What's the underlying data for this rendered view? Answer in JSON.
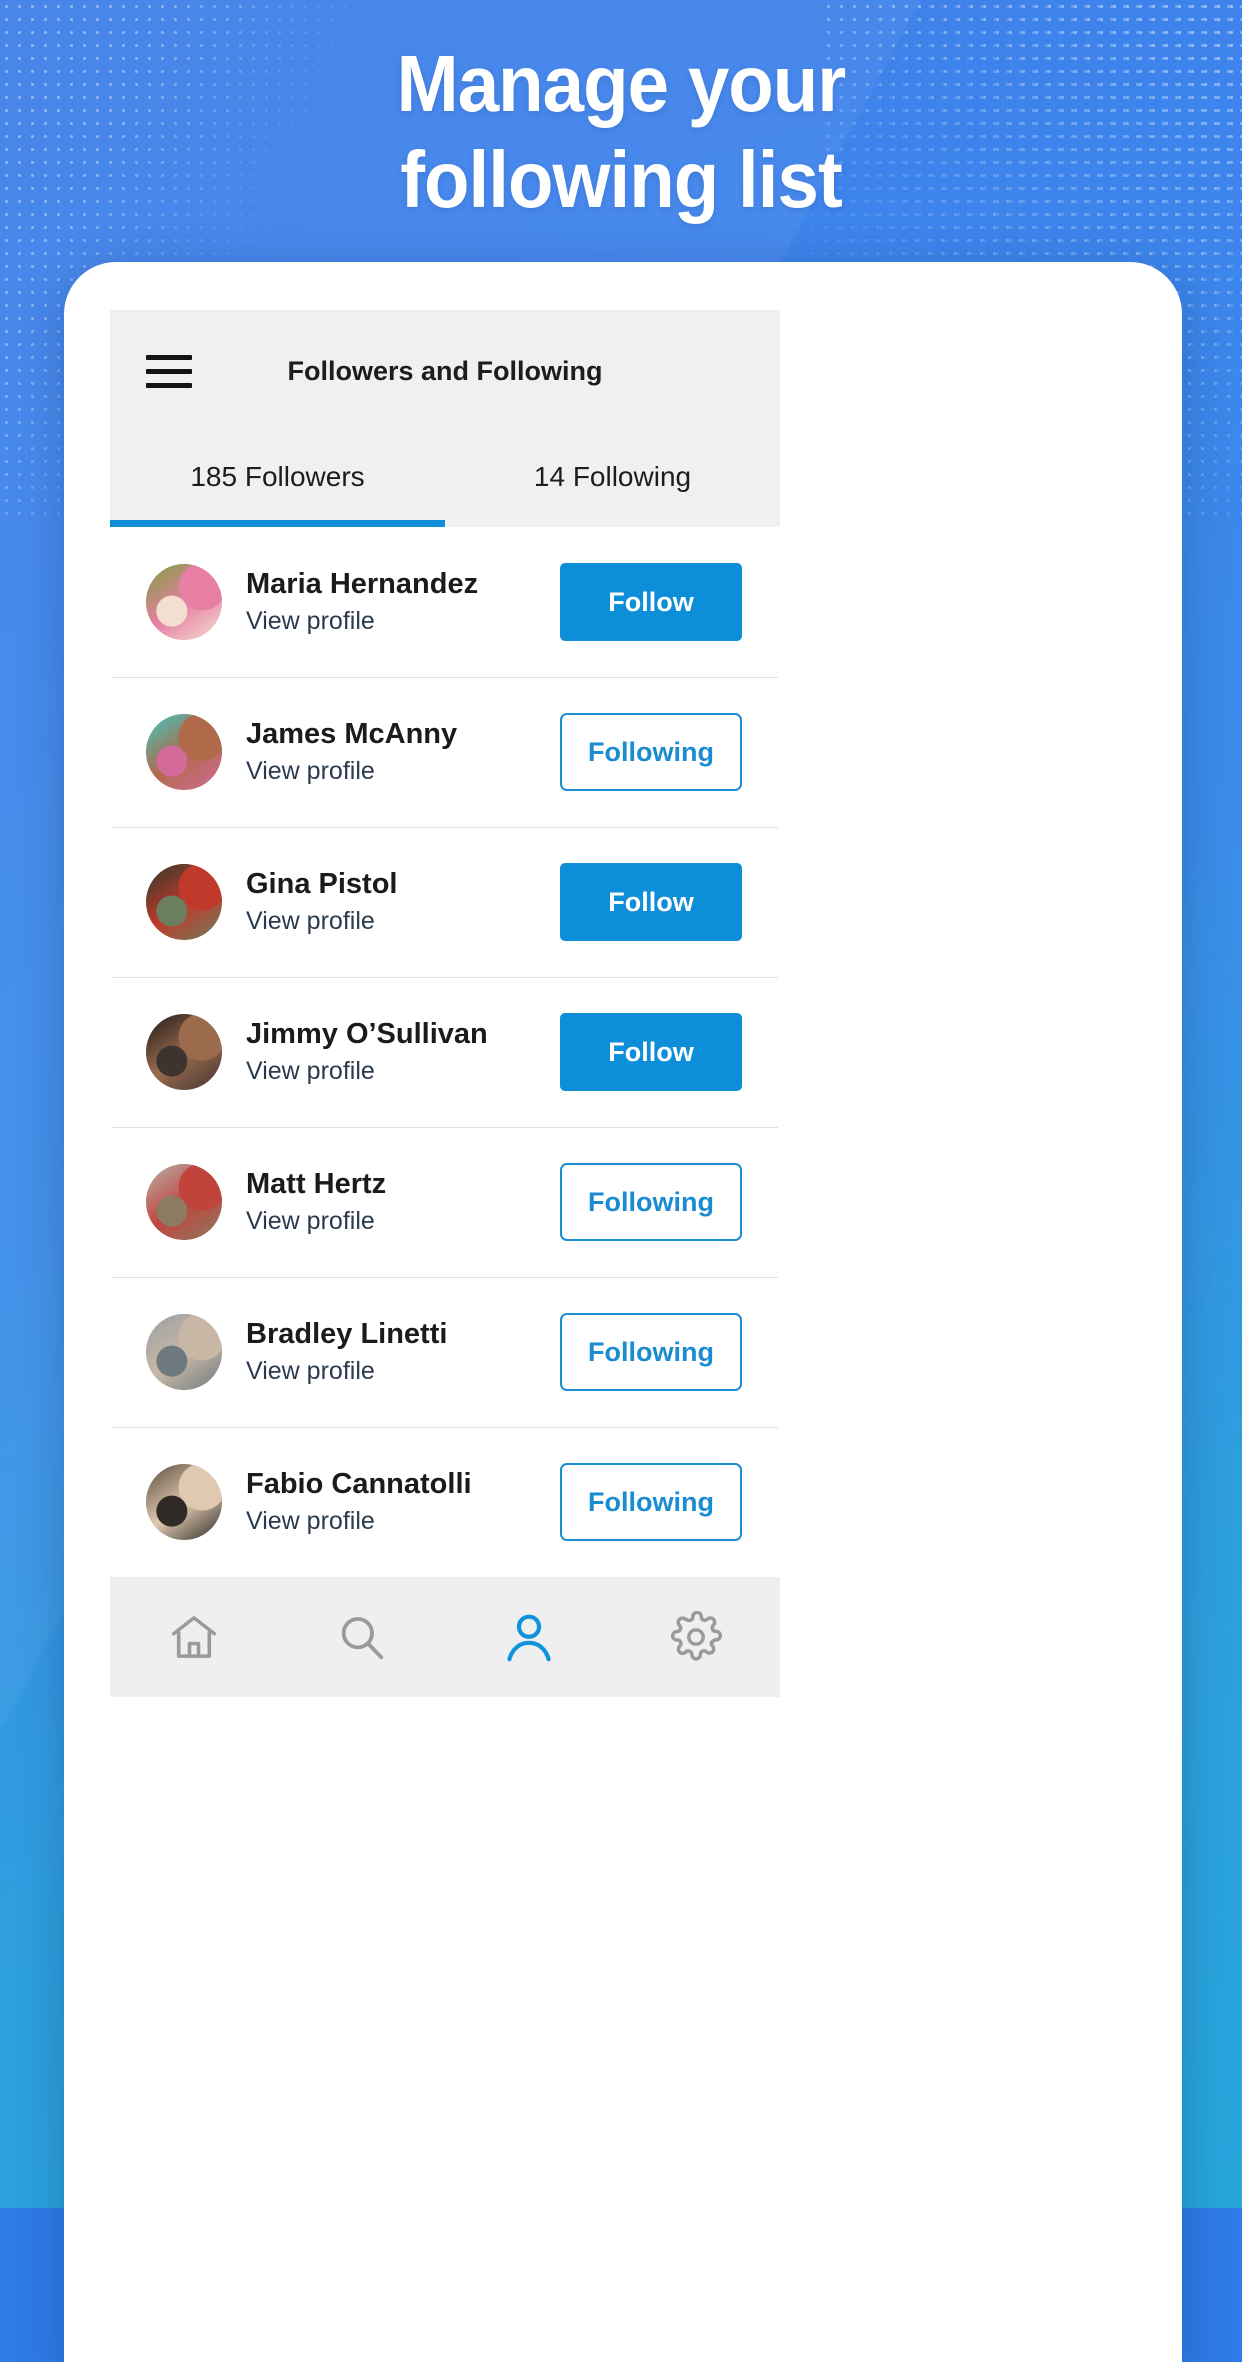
{
  "hero": {
    "line1": "Manage your",
    "line2": "following list",
    "bg_start": "#3f7fe8",
    "bg_end": "#27a6dc"
  },
  "app": {
    "menu_icon": "hamburger-menu-icon",
    "title": "Followers and Following",
    "accent": "#0c8ed9",
    "tabs": [
      {
        "label": "185 Followers",
        "active": true
      },
      {
        "label": "14 Following",
        "active": false
      }
    ],
    "subtitle_label": "View profile",
    "follow_label": "Follow",
    "following_label": "Following",
    "people": [
      {
        "name": "Maria Hernandez",
        "sub": "View profile",
        "action": "Follow",
        "state": "follow",
        "avatar_name": "avatar-maria-hernandez",
        "c1": "#7aa03c",
        "c2": "#e77fa4",
        "c3": "#f3dfd0"
      },
      {
        "name": "James McAnny",
        "sub": "View profile",
        "action": "Following",
        "state": "following",
        "avatar_name": "avatar-james-mcanny",
        "c1": "#3ec7c0",
        "c2": "#b06a4a",
        "c3": "#d46a9a"
      },
      {
        "name": "Gina Pistol",
        "sub": "View profile",
        "action": "Follow",
        "state": "follow",
        "avatar_name": "avatar-gina-pistol",
        "c1": "#2b3a2a",
        "c2": "#c0392b",
        "c3": "#6b7f5e"
      },
      {
        "name": "Jimmy O’Sullivan",
        "sub": "View profile",
        "action": "Follow",
        "state": "follow",
        "avatar_name": "avatar-jimmy-osullivan",
        "c1": "#1c1a18",
        "c2": "#9c6b4e",
        "c3": "#3d3430"
      },
      {
        "name": "Matt Hertz",
        "sub": "View profile",
        "action": "Following",
        "state": "following",
        "avatar_name": "avatar-matt-hertz",
        "c1": "#b8b3ad",
        "c2": "#c0443c",
        "c3": "#8c7a62"
      },
      {
        "name": "Bradley Linetti",
        "sub": "View profile",
        "action": "Following",
        "state": "following",
        "avatar_name": "avatar-bradley-linetti",
        "c1": "#9aa0a2",
        "c2": "#c9b7a6",
        "c3": "#6f7a80"
      },
      {
        "name": "Fabio Cannatolli",
        "sub": "View profile",
        "action": "Following",
        "state": "following",
        "avatar_name": "avatar-fabio-cannatolli",
        "c1": "#5a4a3c",
        "c2": "#e0c9b0",
        "c3": "#2f2a26"
      }
    ],
    "bottom_nav": [
      {
        "icon": "home-icon",
        "active": false
      },
      {
        "icon": "search-icon",
        "active": false
      },
      {
        "icon": "person-icon",
        "active": true
      },
      {
        "icon": "gear-icon",
        "active": false
      }
    ]
  }
}
